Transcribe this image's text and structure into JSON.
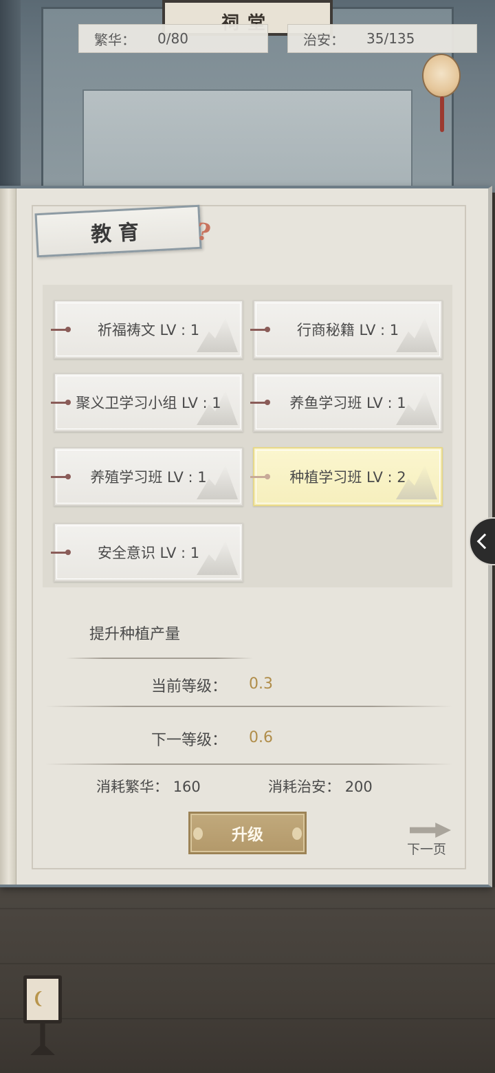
{
  "scene": {
    "plaque_text": "祠堂"
  },
  "stats": {
    "prosperity": {
      "label": "繁华：",
      "value": "0/80"
    },
    "security": {
      "label": "治安：",
      "value": "35/135"
    }
  },
  "panel": {
    "title": "教育",
    "help_icon": "question-mark-icon",
    "skills": [
      {
        "name": "祈福祷文 LV : 1",
        "selected": false
      },
      {
        "name": "行商秘籍 LV : 1",
        "selected": false
      },
      {
        "name": "聚义卫学习小组 LV : 1",
        "selected": false
      },
      {
        "name": "养鱼学习班 LV : 1",
        "selected": false
      },
      {
        "name": "养殖学习班 LV : 1",
        "selected": false
      },
      {
        "name": "种植学习班 LV : 2",
        "selected": true
      },
      {
        "name": "安全意识 LV : 1",
        "selected": false
      }
    ],
    "detail": {
      "description": "提升种植产量",
      "current_level_label": "当前等级：",
      "current_level_value": "0.3",
      "next_level_label": "下一等级：",
      "next_level_value": "0.6",
      "cost_prosperity_label": "消耗繁华：",
      "cost_prosperity_value": "160",
      "cost_security_label": "消耗治安：",
      "cost_security_value": "200"
    },
    "upgrade_label": "升级",
    "next_page_label": "下一页"
  },
  "colors": {
    "value_gold": "#b08d4a",
    "selected_card": "#f6efbd",
    "upgrade_button": "#b3996a"
  }
}
